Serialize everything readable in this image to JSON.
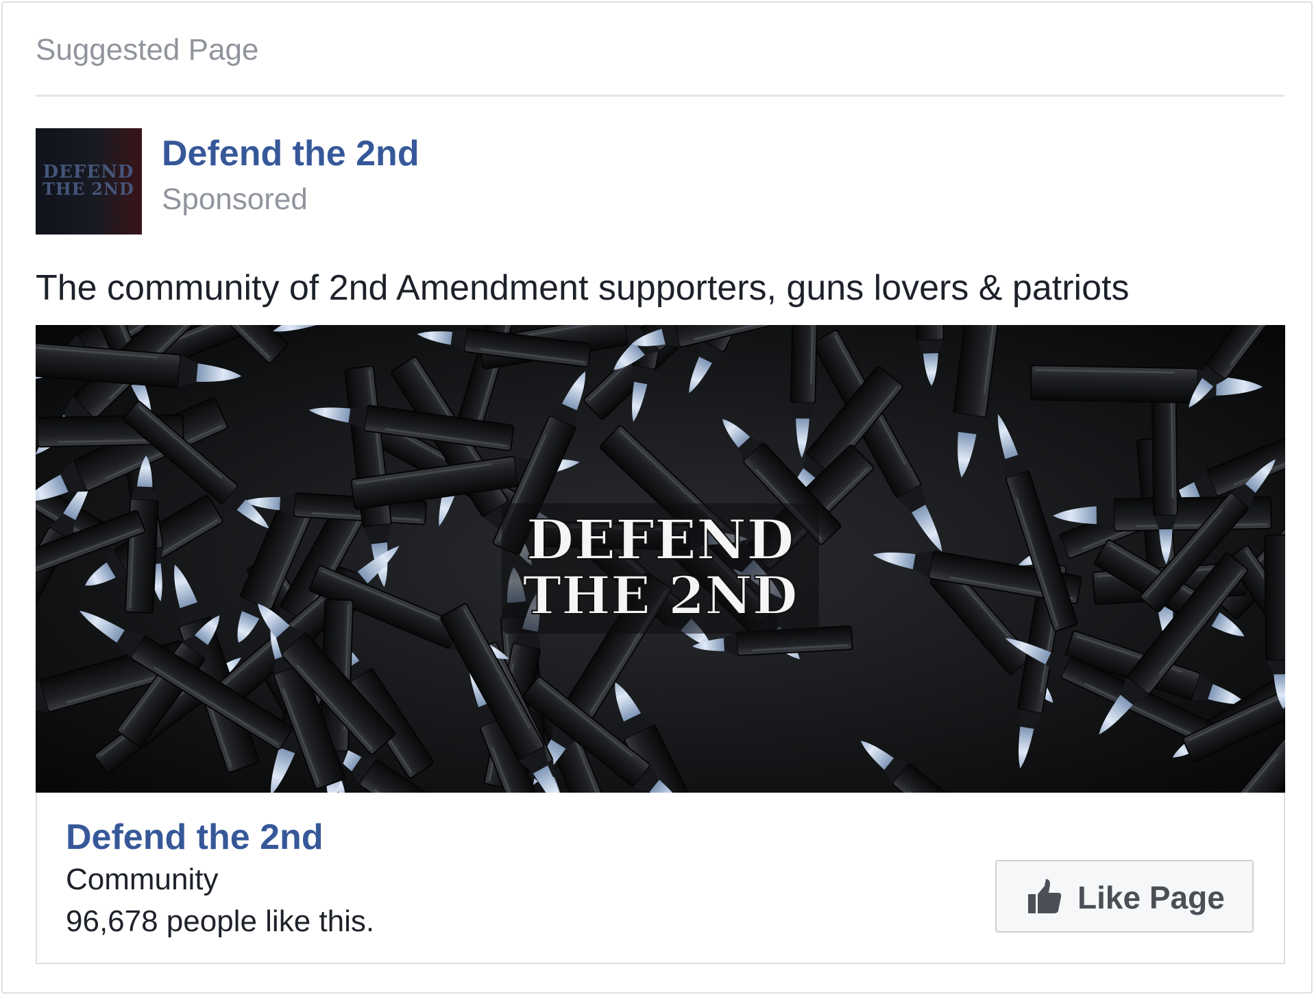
{
  "header": {
    "label": "Suggested Page"
  },
  "post": {
    "page_name": "Defend the 2nd",
    "sponsored_label": "Sponsored",
    "avatar_text": [
      "DEFEND",
      "THE 2ND"
    ],
    "text": "The community of 2nd Amendment supporters, guns lovers & patriots"
  },
  "media": {
    "overlay_line1": "DEFEND",
    "overlay_line2": "THE 2ND"
  },
  "footer": {
    "page_name": "Defend the 2nd",
    "category": "Community",
    "likes_text": "96,678 people like this.",
    "like_button_label": "Like Page",
    "like_icon": "thumbs-up-icon"
  },
  "colors": {
    "link_blue": "#365899",
    "muted_gray": "#90949c",
    "text_dark": "#1d2129",
    "button_bg": "#f6f7f9",
    "button_border": "#ced0d4"
  }
}
